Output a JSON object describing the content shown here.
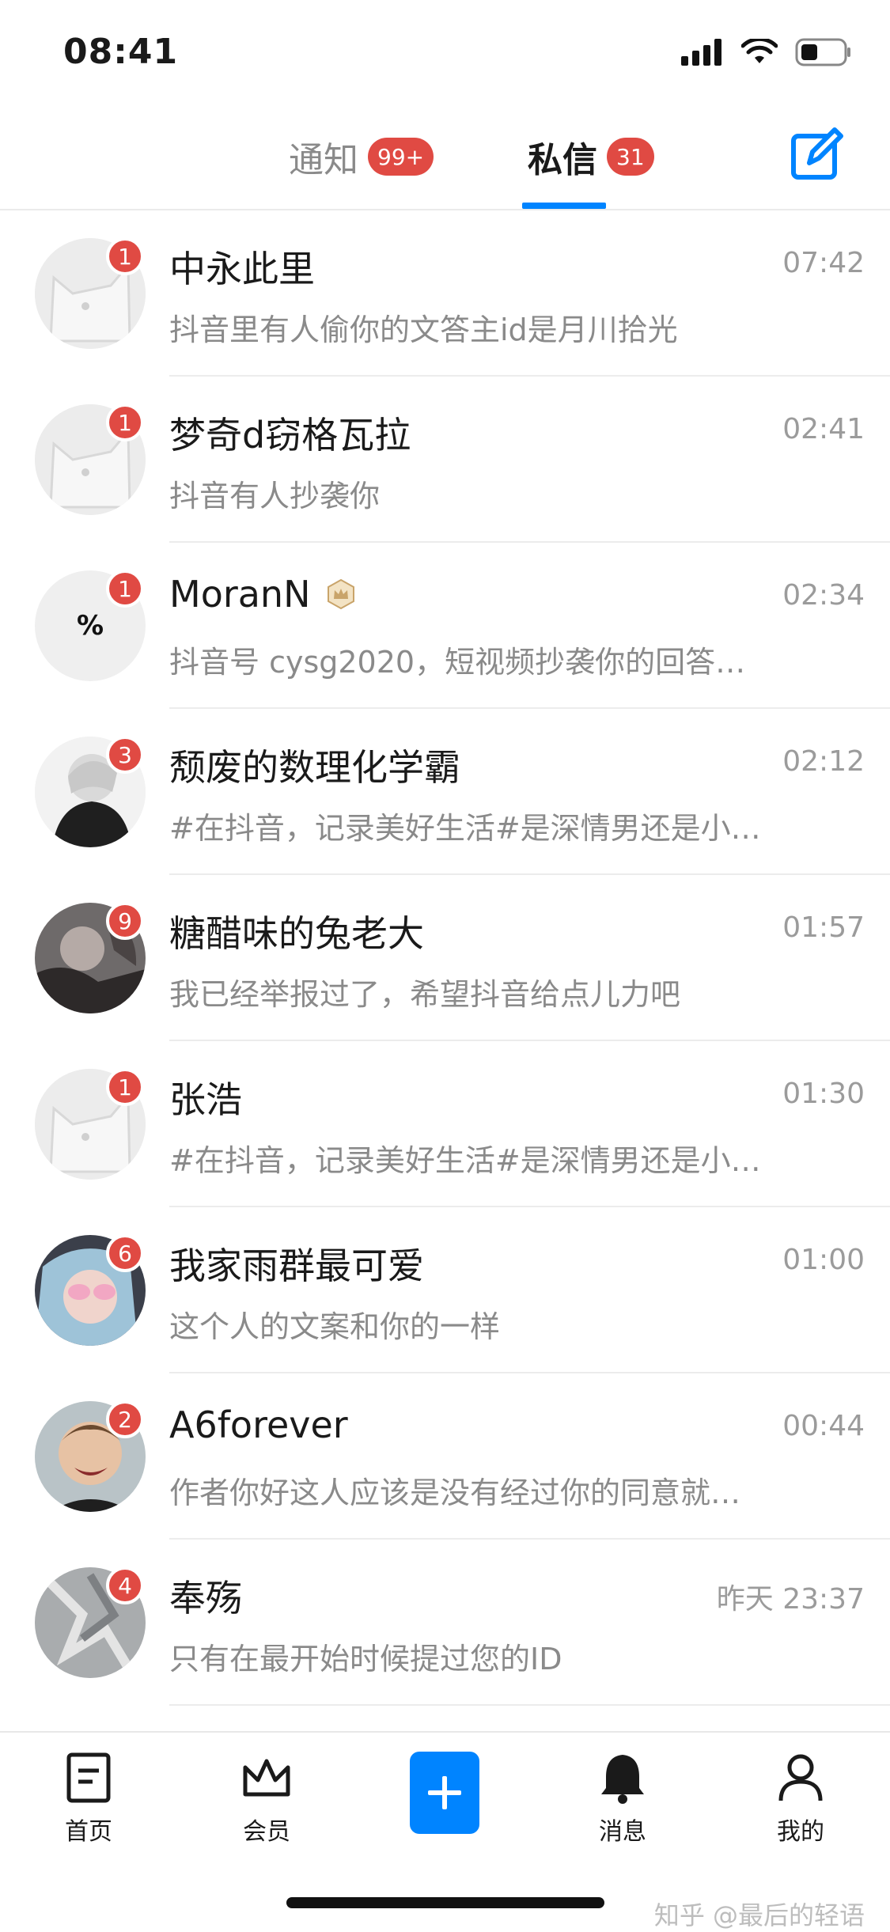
{
  "status_bar": {
    "time": "08:41"
  },
  "header": {
    "tabs": [
      {
        "label": "通知",
        "badge": "99+"
      },
      {
        "label": "私信",
        "badge": "31"
      }
    ],
    "active_tab": "私信"
  },
  "conversations": [
    {
      "name": "中永此里",
      "time": "07:42",
      "preview": "抖音里有人偷你的文答主id是月川拾光",
      "unread": "1",
      "avatar": "default-avatar"
    },
    {
      "name": "梦奇d窃格瓦拉",
      "time": "02:41",
      "preview": "抖音有人抄袭你",
      "unread": "1",
      "avatar": "default-avatar"
    },
    {
      "name": "MoranN",
      "time": "02:34",
      "preview": "抖音号 cysg2020，短视频抄袭你的回答…",
      "unread": "1",
      "avatar": "percent-avatar",
      "avatar_text": "%",
      "vip": true
    },
    {
      "name": "颓废的数理化学霸",
      "time": "02:12",
      "preview": "#在抖音，记录美好生活#是深情男还是小…",
      "unread": "3",
      "avatar": "photo-avatar"
    },
    {
      "name": "糖醋味的兔老大",
      "time": "01:57",
      "preview": "我已经举报过了，希望抖音给点儿力吧",
      "unread": "9",
      "avatar": "photo-avatar"
    },
    {
      "name": "张浩",
      "time": "01:30",
      "preview": "#在抖音，记录美好生活#是深情男还是小…",
      "unread": "1",
      "avatar": "default-avatar"
    },
    {
      "name": "我家雨群最可爱",
      "time": "01:00",
      "preview": "这个人的文案和你的一样",
      "unread": "6",
      "avatar": "photo-avatar"
    },
    {
      "name": "A6forever",
      "time": "00:44",
      "preview": "作者你好这人应该是没有经过你的同意就…",
      "unread": "2",
      "avatar": "photo-avatar"
    },
    {
      "name": "奉殇",
      "time": "昨天 23:37",
      "preview": "只有在最开始时候提过您的ID",
      "unread": "4",
      "avatar": "photo-avatar"
    }
  ],
  "tabbar": {
    "items": [
      {
        "label": "首页",
        "icon": "document-icon"
      },
      {
        "label": "会员",
        "icon": "crown-icon"
      },
      {
        "label": "",
        "icon": "plus-icon"
      },
      {
        "label": "消息",
        "icon": "bell-icon"
      },
      {
        "label": "我的",
        "icon": "person-icon"
      }
    ]
  },
  "watermark": "知乎 @最后的轻语",
  "colors": {
    "accent": "#0084ff",
    "badge": "#e04a43",
    "muted_text": "#8a8a8a"
  }
}
